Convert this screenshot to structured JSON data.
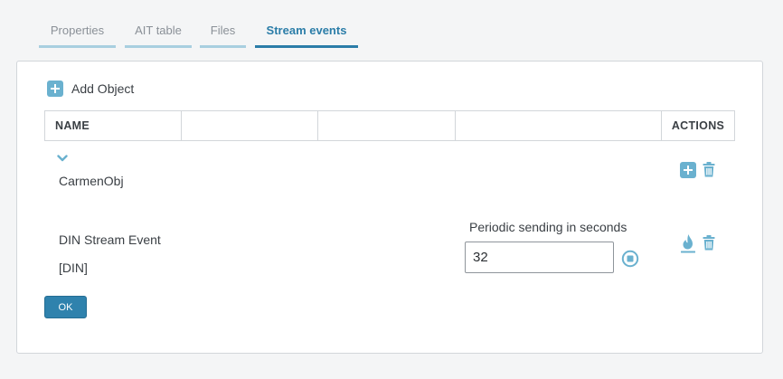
{
  "tabs": [
    {
      "label": "Properties",
      "active": false
    },
    {
      "label": "AIT table",
      "active": false
    },
    {
      "label": "Files",
      "active": false
    },
    {
      "label": "Stream events",
      "active": true
    }
  ],
  "toolbar": {
    "add_object_label": "Add Object"
  },
  "table": {
    "headers": [
      "NAME",
      "",
      "",
      "",
      "ACTIONS"
    ]
  },
  "object": {
    "name": "CarmenObj"
  },
  "stream_event": {
    "name": "DIN Stream Event",
    "tag": "[DIN]",
    "period_label": "Periodic sending in seconds",
    "period_value": "32"
  },
  "footer": {
    "ok_label": "OK"
  },
  "colors": {
    "accent": "#2b7da8",
    "icon": "#6ab1cf",
    "tab_inactive_bar": "#a8cfe0"
  },
  "icons": [
    "plus-square-icon",
    "chevron-down-icon",
    "trash-icon",
    "fire-icon",
    "stop-circle-icon"
  ]
}
